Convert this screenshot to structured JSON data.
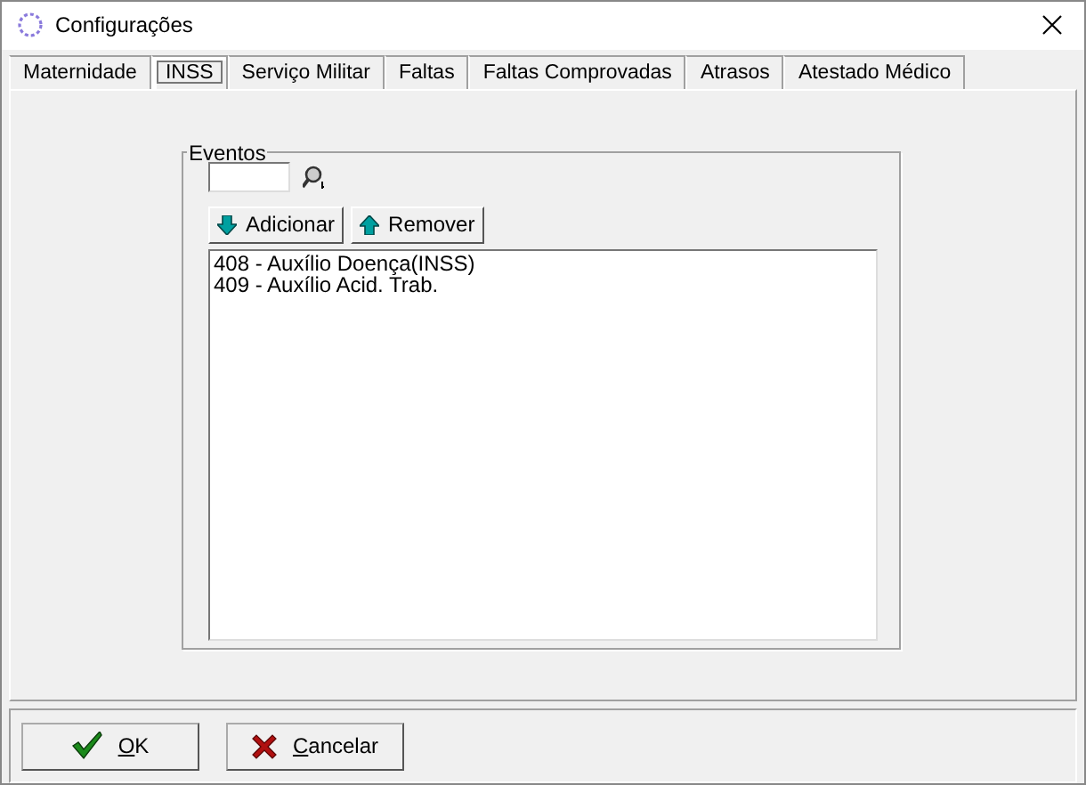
{
  "window": {
    "title": "Configurações"
  },
  "tabs": [
    {
      "label": "Maternidade",
      "selected": false
    },
    {
      "label": "INSS",
      "selected": true
    },
    {
      "label": "Serviço Militar",
      "selected": false
    },
    {
      "label": "Faltas",
      "selected": false
    },
    {
      "label": "Faltas Comprovadas",
      "selected": false
    },
    {
      "label": "Atrasos",
      "selected": false
    },
    {
      "label": "Atestado Médico",
      "selected": false
    }
  ],
  "group": {
    "title": "Eventos",
    "buttons": [
      {
        "label": "Adicionar",
        "kind": "down"
      },
      {
        "label": "Remover",
        "kind": "up"
      }
    ],
    "list": [
      "408 - Auxílio Doença(INSS)",
      "409 - Auxílio Acid. Trab."
    ]
  },
  "footer_buttons": [
    {
      "label": "OK",
      "kind": "ok"
    },
    {
      "label": "Cancelar",
      "kind": "cancel"
    }
  ]
}
